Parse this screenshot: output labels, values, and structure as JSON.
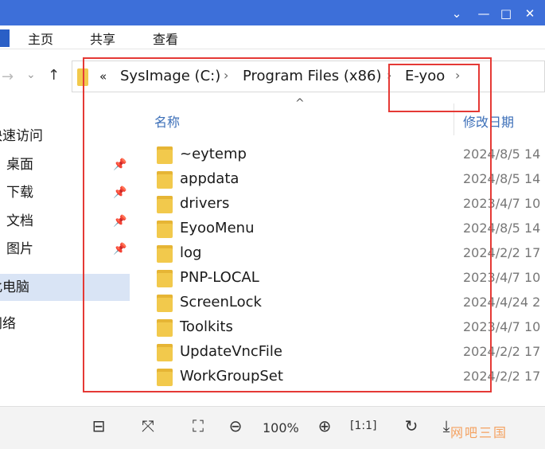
{
  "window": {
    "controls": [
      "chevron-down",
      "minimize",
      "maximize",
      "close"
    ]
  },
  "ribbon": {
    "tabs": [
      "主页",
      "共享",
      "查看"
    ]
  },
  "address": {
    "overflow": "«",
    "crumbs": [
      "SysImage (C:)",
      "Program Files (x86)",
      "E-yoo"
    ]
  },
  "sidebar": {
    "quick_access": "快速访问",
    "items": [
      "桌面",
      "下载",
      "文档",
      "图片"
    ],
    "this_pc": "此电脑",
    "network": "网络"
  },
  "file_list": {
    "col_name": "名称",
    "col_date": "修改日期",
    "rows": [
      {
        "name": "~eytemp",
        "date": "2024/8/5 14"
      },
      {
        "name": "appdata",
        "date": "2024/8/5 14"
      },
      {
        "name": "drivers",
        "date": "2023/4/7 10"
      },
      {
        "name": "EyooMenu",
        "date": "2024/8/5 14"
      },
      {
        "name": "log",
        "date": "2024/2/2 17"
      },
      {
        "name": "PNP-LOCAL",
        "date": "2023/4/7 10"
      },
      {
        "name": "ScreenLock",
        "date": "2024/4/24 2"
      },
      {
        "name": "Toolkits",
        "date": "2023/4/7 10"
      },
      {
        "name": "UpdateVncFile",
        "date": "2024/2/2 17"
      },
      {
        "name": "WorkGroupSet",
        "date": "2024/2/2 17"
      }
    ]
  },
  "toolbar": {
    "zoom": "100%",
    "watermark": "网吧三国"
  },
  "colors": {
    "titlebar": "#3d6fd9",
    "annotation": "#e53935",
    "folder": "#f2c94c",
    "selection": "#d9e4f5"
  }
}
